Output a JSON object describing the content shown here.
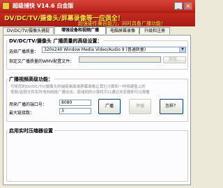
{
  "window": {
    "title": "超级捕快 V14.6 白金版",
    "minimize_label": "_",
    "close_label": "×"
  },
  "banner": {
    "headline": "DV/DC/TV/摄像头/屏幕录像等一应俱全！",
    "subline": "超强硬件兼容能力，同时具备广播功能！"
  },
  "tabs": {
    "row1": [
      {
        "label": "DV/DC/TV/摄像头捕捉"
      },
      {
        "label": "增强设备和视频广播"
      },
      {
        "label": "电脑屏幕录像"
      },
      {
        "label": "升级和注册"
      }
    ],
    "active_index": 1
  },
  "quality_group": {
    "title": "DV/DC/TV/摄像头 广播质量的高级设置：",
    "quality_label": "选择广播质量：",
    "quality_value": "320x240 Window Media Video/Audio 9 (普通质量)",
    "custom_label": "指定文广播质量的WMV配置文件：",
    "custom_value": "",
    "browse_label": "浏览..."
  },
  "broadcast_group": {
    "title": "广播视频高级功能：",
    "desc_line1": "可将您的DV/DC/TV/摄像头的捕捉画面或屏幕录像让其它计算机一样将硬盘上的",
    "desc_line2": "视频/音频文件实时地向网络广播出去。局域网的计算机可以通过浏览器即可以观看",
    "port_label": "用来广播的端口号：",
    "port_value": "8080",
    "max_label": "最大链接数：",
    "max_value": "3",
    "broadcast_label": "广播",
    "stop_label": "停播",
    "howto_label": "怎样？"
  },
  "compress_group": {
    "title": "启用实时压缩器设置"
  }
}
